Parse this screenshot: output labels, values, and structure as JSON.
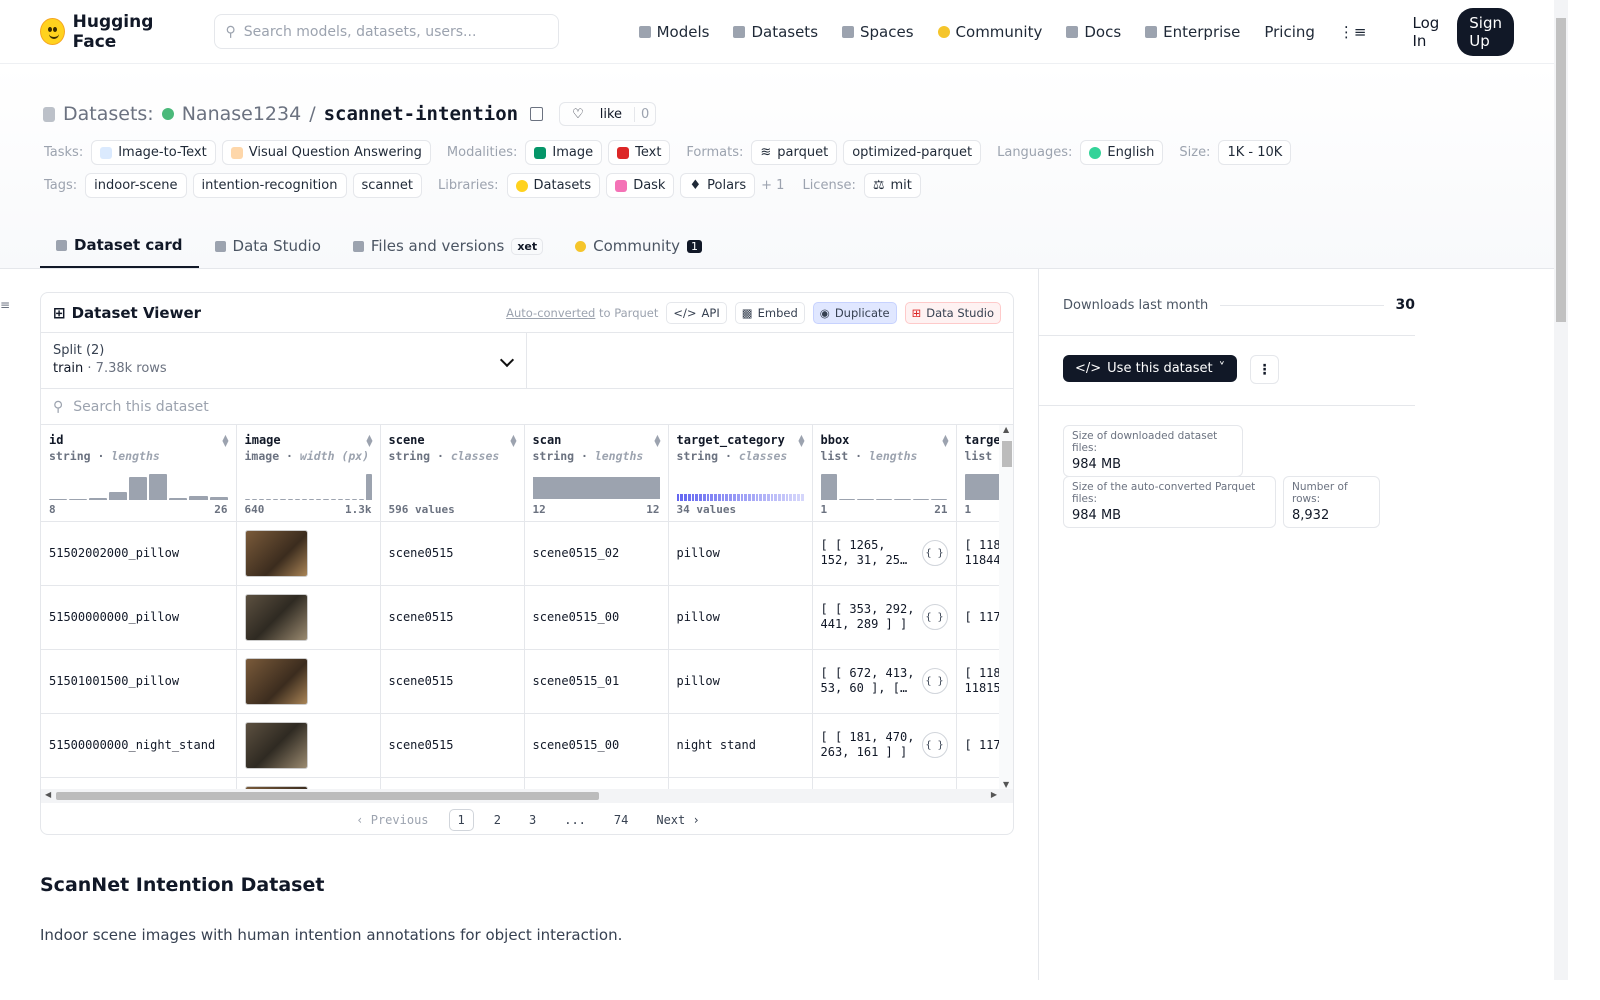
{
  "nav": {
    "brand": "Hugging Face",
    "search_placeholder": "Search models, datasets, users...",
    "links": [
      "Models",
      "Datasets",
      "Spaces",
      "Community",
      "Docs",
      "Enterprise",
      "Pricing"
    ],
    "login": "Log In",
    "signup": "Sign Up"
  },
  "repo": {
    "section": "Datasets:",
    "owner": "Nanase1234",
    "separator": "/",
    "name": "scannet-intention",
    "like_label": "like",
    "like_count": "0"
  },
  "meta": {
    "tasks_label": "Tasks:",
    "tasks": [
      "Image-to-Text",
      "Visual Question Answering"
    ],
    "modalities_label": "Modalities:",
    "modalities": [
      "Image",
      "Text"
    ],
    "formats_label": "Formats:",
    "formats": [
      "parquet",
      "optimized-parquet"
    ],
    "languages_label": "Languages:",
    "languages": [
      "English"
    ],
    "size_label": "Size:",
    "size": "1K - 10K",
    "tags_label": "Tags:",
    "tags": [
      "indoor-scene",
      "intention-recognition",
      "scannet"
    ],
    "libraries_label": "Libraries:",
    "libraries": [
      "Datasets",
      "Dask",
      "Polars"
    ],
    "libraries_more": "+ 1",
    "license_label": "License:",
    "license": "mit"
  },
  "tabs": [
    {
      "label": "Dataset card"
    },
    {
      "label": "Data Studio"
    },
    {
      "label": "Files and versions",
      "badge": "xet"
    },
    {
      "label": "Community",
      "badge": "1"
    }
  ],
  "viewer": {
    "title": "Dataset Viewer",
    "auto_converted": "Auto-converted",
    "to_parquet": "to Parquet",
    "api": "API",
    "embed": "Embed",
    "duplicate": "Duplicate",
    "data_studio": "Data Studio",
    "split_label": "Split (2)",
    "split_name": "train",
    "split_rows": "7.38k rows",
    "search_placeholder": "Search this dataset",
    "columns": [
      {
        "name": "id",
        "type": "string",
        "stat": "lengths",
        "min": "8",
        "max": "26",
        "hist": [
          0.05,
          0.05,
          0.08,
          0.3,
          0.85,
          0.95,
          0.08,
          0.15,
          0.1
        ]
      },
      {
        "name": "image",
        "type": "image",
        "stat": "width (px)",
        "min": "640",
        "max": "1.3k",
        "hist": [
          0.05,
          0,
          0,
          0,
          0,
          0,
          0,
          0,
          0,
          0,
          0,
          0,
          0,
          0,
          0,
          0,
          0,
          0.95
        ]
      },
      {
        "name": "scene",
        "type": "string",
        "stat": "classes",
        "values": "596 values"
      },
      {
        "name": "scan",
        "type": "string",
        "stat": "lengths",
        "min": "12",
        "max": "12"
      },
      {
        "name": "target_category",
        "type": "string",
        "stat": "classes",
        "values": "34 values"
      },
      {
        "name": "bbox",
        "type": "list",
        "stat": "lengths",
        "min": "1",
        "max": "21",
        "hist": [
          0.95,
          0.05,
          0.05,
          0.05,
          0.05,
          0.05,
          0.05
        ]
      },
      {
        "name": "targe",
        "type": "list",
        "stat": "",
        "min": "1",
        "max": "",
        "hist": [
          0.95,
          0.05
        ]
      }
    ],
    "rows": [
      {
        "id": "51502002000_pillow",
        "scene": "scene0515",
        "scan": "scene0515_02",
        "target": "pillow",
        "bbox": "[ [ 1265,\n152, 31, 25…",
        "last": "[ 118\n11844"
      },
      {
        "id": "51500000000_pillow",
        "scene": "scene0515",
        "scan": "scene0515_00",
        "target": "pillow",
        "bbox": "[ [ 353, 292,\n441, 289 ] ]",
        "last": "[ 117"
      },
      {
        "id": "51501001500_pillow",
        "scene": "scene0515",
        "scan": "scene0515_01",
        "target": "pillow",
        "bbox": "[ [ 672, 413,\n53, 60 ], […",
        "last": "[ 118\n11815"
      },
      {
        "id": "51500000000_night_stand",
        "scene": "scene0515",
        "scan": "scene0515_00",
        "target": "night stand",
        "bbox": "[ [ 181, 470,\n263, 161 ] ]",
        "last": "[ 117"
      }
    ],
    "pager": {
      "prev": "Previous",
      "pages": [
        "1",
        "2",
        "3",
        "...",
        "74"
      ],
      "next": "Next",
      "current": "1"
    }
  },
  "card": {
    "heading": "ScanNet Intention Dataset",
    "description": "Indoor scene images with human intention annotations for object interaction."
  },
  "sidebar": {
    "downloads_label": "Downloads last month",
    "downloads": "30",
    "use_button": "Use this dataset",
    "size_downloaded_label": "Size of downloaded dataset files:",
    "size_downloaded": "984 MB",
    "size_parquet_label": "Size of the auto-converted Parquet files:",
    "size_parquet": "984 MB",
    "rows_label": "Number of rows:",
    "rows": "8,932"
  }
}
